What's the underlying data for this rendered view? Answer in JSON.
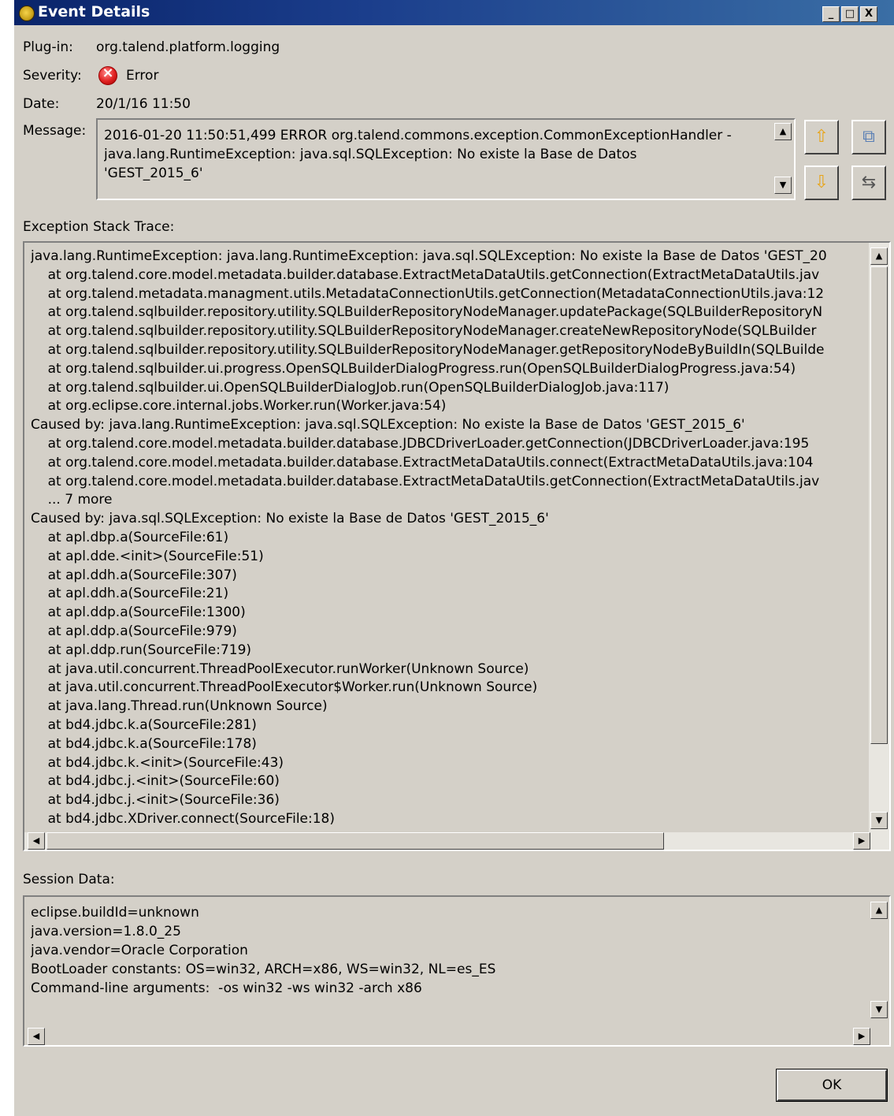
{
  "window": {
    "title": "Event Details",
    "controls": {
      "minimize": "_",
      "maximize": "□",
      "close": "X"
    }
  },
  "fields": {
    "plugin_label": "Plug-in:",
    "plugin_value": "org.talend.platform.logging",
    "severity_label": "Severity:",
    "severity_value": "Error",
    "severity_icon": "error-icon",
    "date_label": "Date:",
    "date_value": "20/1/16 11:50",
    "message_label": "Message:",
    "message_value": "2016-01-20 11:50:51,499 ERROR org.talend.commons.exception.CommonExceptionHandler -\njava.lang.RuntimeException: java.sql.SQLException: No existe la Base de Datos\n'GEST_2015_6'"
  },
  "side_buttons": {
    "previous": "previous-event-icon",
    "next": "next-event-icon",
    "copy": "copy-icon",
    "filter": "filter-icon"
  },
  "stack_trace": {
    "label": "Exception Stack Trace:",
    "lines": [
      "java.lang.RuntimeException: java.lang.RuntimeException: java.sql.SQLException: No existe la Base de Datos 'GEST_20",
      "    at org.talend.core.model.metadata.builder.database.ExtractMetaDataUtils.getConnection(ExtractMetaDataUtils.jav",
      "    at org.talend.metadata.managment.utils.MetadataConnectionUtils.getConnection(MetadataConnectionUtils.java:12",
      "    at org.talend.sqlbuilder.repository.utility.SQLBuilderRepositoryNodeManager.updatePackage(SQLBuilderRepositoryN",
      "    at org.talend.sqlbuilder.repository.utility.SQLBuilderRepositoryNodeManager.createNewRepositoryNode(SQLBuilder",
      "    at org.talend.sqlbuilder.repository.utility.SQLBuilderRepositoryNodeManager.getRepositoryNodeByBuildIn(SQLBuilde",
      "    at org.talend.sqlbuilder.ui.progress.OpenSQLBuilderDialogProgress.run(OpenSQLBuilderDialogProgress.java:54)",
      "    at org.talend.sqlbuilder.ui.OpenSQLBuilderDialogJob.run(OpenSQLBuilderDialogJob.java:117)",
      "    at org.eclipse.core.internal.jobs.Worker.run(Worker.java:54)",
      "Caused by: java.lang.RuntimeException: java.sql.SQLException: No existe la Base de Datos 'GEST_2015_6'",
      "    at org.talend.core.model.metadata.builder.database.JDBCDriverLoader.getConnection(JDBCDriverLoader.java:195",
      "    at org.talend.core.model.metadata.builder.database.ExtractMetaDataUtils.connect(ExtractMetaDataUtils.java:104",
      "    at org.talend.core.model.metadata.builder.database.ExtractMetaDataUtils.getConnection(ExtractMetaDataUtils.jav",
      "    ... 7 more",
      "Caused by: java.sql.SQLException: No existe la Base de Datos 'GEST_2015_6'",
      "    at apl.dbp.a(SourceFile:61)",
      "    at apl.dde.<init>(SourceFile:51)",
      "    at apl.ddh.a(SourceFile:307)",
      "    at apl.ddh.a(SourceFile:21)",
      "    at apl.ddp.a(SourceFile:1300)",
      "    at apl.ddp.a(SourceFile:979)",
      "    at apl.ddp.run(SourceFile:719)",
      "    at java.util.concurrent.ThreadPoolExecutor.runWorker(Unknown Source)",
      "    at java.util.concurrent.ThreadPoolExecutor$Worker.run(Unknown Source)",
      "    at java.lang.Thread.run(Unknown Source)",
      "    at bd4.jdbc.k.a(SourceFile:281)",
      "    at bd4.jdbc.k.a(SourceFile:178)",
      "    at bd4.jdbc.k.<init>(SourceFile:43)",
      "    at bd4.jdbc.j.<init>(SourceFile:60)",
      "    at bd4.jdbc.j.<init>(SourceFile:36)",
      "    at bd4.jdbc.XDriver.connect(SourceFile:18)"
    ]
  },
  "session": {
    "label": "Session Data:",
    "lines": [
      "eclipse.buildId=unknown",
      "java.version=1.8.0_25",
      "java.vendor=Oracle Corporation",
      "BootLoader constants: OS=win32, ARCH=x86, WS=win32, NL=es_ES",
      "Command-line arguments:  -os win32 -ws win32 -arch x86"
    ]
  },
  "ok_button": {
    "label": "OK"
  }
}
